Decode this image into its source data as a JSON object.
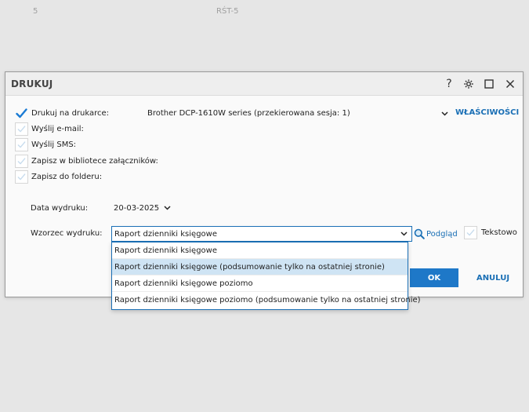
{
  "background": {
    "col_left": "5",
    "col_right": "RŚT-5"
  },
  "dialog": {
    "title": "DRUKUJ",
    "controls": {
      "help": "?",
      "settings": "gear",
      "maximize": "square",
      "close": "×"
    },
    "options": [
      {
        "label": "Drukuj na drukarce:",
        "checked": true
      },
      {
        "label": "Wyślij e-mail:",
        "checked": false
      },
      {
        "label": "Wyślij SMS:",
        "checked": false
      },
      {
        "label": "Zapisz w bibliotece załączników:",
        "checked": false
      },
      {
        "label": "Zapisz do folderu:",
        "checked": false
      }
    ],
    "printer": {
      "value": "Brother DCP-1610W series (przekierowana sesja: 1)",
      "properties_label": "WŁAŚCIWOŚCI"
    },
    "date": {
      "label": "Data wydruku:",
      "value": "20-03-2025"
    },
    "template": {
      "label": "Wzorzec wydruku:",
      "value": "Raport dzienniki księgowe",
      "preview_label": "Podgląd",
      "text_label": "Tekstowo",
      "options": [
        "Raport dzienniki księgowe",
        "Raport dzienniki księgowe (podsumowanie tylko na ostatniej stronie)",
        "Raport dzienniki księgowe poziomo",
        "Raport dzienniki księgowe poziomo (podsumowanie tylko na ostatniej stronie)"
      ],
      "highlighted_index": 1
    },
    "buttons": {
      "ok": "OK",
      "cancel": "ANULUJ"
    }
  },
  "colors": {
    "accent": "#1e78c8",
    "link": "#1a6fb5",
    "highlight": "#cfe4f4",
    "check": "#1a7bd4"
  },
  "icons": {
    "check": "check-icon",
    "chevron": "chevron-down-icon",
    "preview": "magnifier-icon"
  }
}
